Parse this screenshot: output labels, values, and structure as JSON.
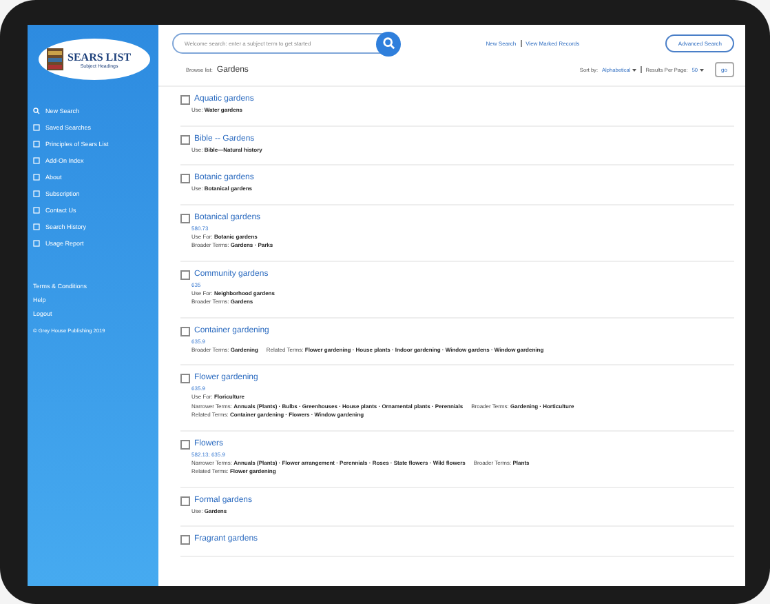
{
  "logo": {
    "title": "SEARS LIST",
    "subtitle": "Subject Headings"
  },
  "sidebar": {
    "items": [
      {
        "label": "New Search",
        "kind": "search"
      },
      {
        "label": "Saved Searches",
        "kind": "page"
      },
      {
        "label": "Principles of Sears List",
        "kind": "page"
      },
      {
        "label": "Add-On Index",
        "kind": "page"
      },
      {
        "label": "About",
        "kind": "page"
      },
      {
        "label": "Subscription",
        "kind": "page"
      },
      {
        "label": "Contact Us",
        "kind": "page"
      },
      {
        "label": "Search History",
        "kind": "page"
      },
      {
        "label": "Usage Report",
        "kind": "page"
      }
    ],
    "footer_links": [
      "Terms & Conditions",
      "Help",
      "Logout"
    ],
    "copyright": "© Grey House Publishing 2019"
  },
  "search": {
    "placeholder": "Welcome search: enter a subject term to get started"
  },
  "top_links": [
    "New Search",
    "View Marked Records"
  ],
  "advanced_button": "Advanced Search",
  "browse": {
    "label": "Browse list:",
    "term": "Gardens"
  },
  "sort": {
    "label": "Sort by:",
    "value": "Alphabetical"
  },
  "per_page": {
    "label": "Results Per Page:",
    "value": "50"
  },
  "go_button": "go",
  "entries": [
    {
      "title": "Aquatic gardens",
      "checked": false,
      "lines": [
        [
          {
            "label": "Use:",
            "value": "Water gardens"
          }
        ]
      ]
    },
    {
      "title": "Bible -- Gardens",
      "checked": false,
      "lines": [
        [
          {
            "label": "Use:",
            "value": "Bible—Natural history"
          }
        ]
      ]
    },
    {
      "title": "Botanic gardens",
      "checked": false,
      "lines": [
        [
          {
            "label": "Use:",
            "value": "Botanical gardens"
          }
        ]
      ]
    },
    {
      "title": "Botanical gardens",
      "number": "580.73",
      "checked": false,
      "lines": [
        [
          {
            "label": "Use For:",
            "value": "Botanic gardens"
          }
        ],
        [
          {
            "label": "Broader Terms:",
            "value": "Gardens · Parks"
          }
        ]
      ]
    },
    {
      "title": "Community gardens",
      "number": "635",
      "checked": false,
      "lines": [
        [
          {
            "label": "Use For:",
            "value": "Neighborhood gardens"
          }
        ],
        [
          {
            "label": "Broader Terms:",
            "value": "Gardens"
          }
        ]
      ]
    },
    {
      "title": "Container gardening",
      "number": "635.9",
      "checked": false,
      "lines": [
        [
          {
            "label": "Broader Terms:",
            "value": "Gardening"
          },
          {
            "label": "Related Terms:",
            "value": "Flower gardening · House plants · Indoor gardening · Window gardens · Window gardening"
          }
        ]
      ]
    },
    {
      "title": "Flower gardening",
      "number": "635.9",
      "checked": false,
      "lines": [
        [
          {
            "label": "Use For:",
            "value": "Floriculture"
          }
        ],
        [
          {
            "label": "Narrower Terms:",
            "value": "Annuals (Plants) · Bulbs · Greenhouses · House plants · Ornamental plants · Perennials"
          },
          {
            "label": "Broader Terms:",
            "value": "Gardening · Horticulture"
          }
        ],
        [
          {
            "label": "Related Terms:",
            "value": "Container gardening · Flowers · Window gardening"
          }
        ]
      ]
    },
    {
      "title": "Flowers",
      "number": "582.13; 635.9",
      "checked": false,
      "lines": [
        [
          {
            "label": "Narrower Terms:",
            "value": "Annuals (Plants) · Flower arrangement · Perennials · Roses · State flowers · Wild flowers"
          },
          {
            "label": "Broader Terms:",
            "value": "Plants"
          }
        ],
        [
          {
            "label": "Related Terms:",
            "value": "Flower gardening"
          }
        ]
      ]
    },
    {
      "title": "Formal gardens",
      "checked": false,
      "lines": [
        [
          {
            "label": "Use:",
            "value": "Gardens"
          }
        ]
      ]
    },
    {
      "title": "Fragrant gardens",
      "checked": false
    }
  ]
}
